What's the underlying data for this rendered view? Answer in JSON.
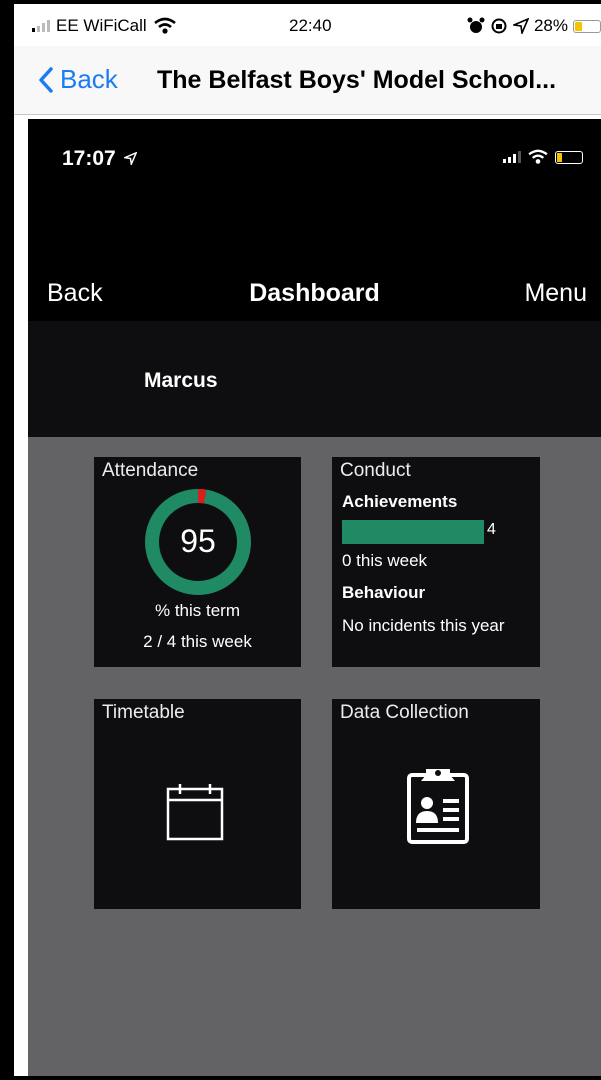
{
  "outer_status": {
    "carrier": "EE WiFiCall",
    "time": "22:40",
    "battery_percent": "28%",
    "icons": [
      "signal-bars-icon",
      "wifi-icon",
      "alarm-icon",
      "screen-rotation-lock-icon",
      "location-arrow-icon",
      "battery-icon"
    ]
  },
  "outer_nav": {
    "back_label": "Back",
    "title": "The Belfast Boys' Model School..."
  },
  "inner_status": {
    "time": "17:07",
    "icons": [
      "location-arrow-icon",
      "signal-bars-icon",
      "wifi-icon",
      "battery-icon"
    ]
  },
  "inner_nav": {
    "back_label": "Back",
    "title": "Dashboard",
    "menu_label": "Menu"
  },
  "student": {
    "name": "Marcus"
  },
  "tiles": {
    "attendance": {
      "label": "Attendance",
      "value": "95",
      "percent": 95,
      "subtitle": "% this term",
      "week": "2 / 4 this week",
      "colors": {
        "ring": "#1f8a63",
        "missing": "#d81f1f"
      }
    },
    "conduct": {
      "label": "Conduct",
      "achievements_heading": "Achievements",
      "achievements_count": "4",
      "achievements_week": "0 this week",
      "behaviour_heading": "Behaviour",
      "behaviour_text": "No incidents this year",
      "bar_color": "#1f8a63"
    },
    "timetable": {
      "label": "Timetable",
      "icon": "calendar-icon"
    },
    "data_collection": {
      "label": "Data Collection",
      "icon": "clipboard-icon"
    }
  },
  "colors": {
    "ios_blue": "#1a7cf5",
    "tile_bg": "#0e0e10",
    "page_bg": "#636366"
  }
}
